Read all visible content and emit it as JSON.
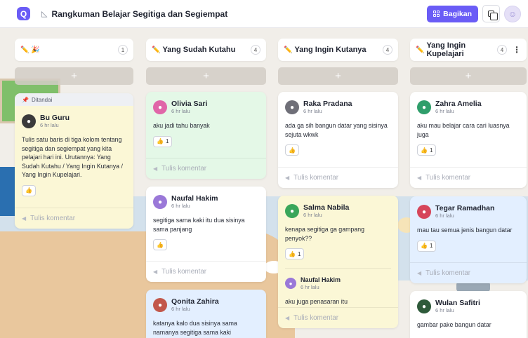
{
  "header": {
    "logo_letter": "Q",
    "title_icon": "◺",
    "title": "Rangkuman Belajar Segitiga dan Segiempat",
    "share_label": "Bagikan"
  },
  "columns": [
    {
      "title": "",
      "icons": "✏️ 🎉",
      "count": "1"
    },
    {
      "title": "Yang Sudah Kutahu",
      "icons": "✏️",
      "count": "4"
    },
    {
      "title": "Yang Ingin Kutanya",
      "icons": "✏️",
      "count": "4"
    },
    {
      "title": "Yang Ingin Kupelajari",
      "icons": "✏️",
      "count": "4"
    }
  ],
  "add_symbol": "+",
  "comment_placeholder": "Tulis komentar",
  "pinned_label": "Ditandai",
  "cards": {
    "teacher": {
      "name": "Bu Guru",
      "time": "6 hr lalu",
      "text": "Tulis satu baris di tiga kolom tentang segitiga dan segiempat yang kita pelajari hari ini. Urutannya: Yang Sudah Kutahu / Yang Ingin Kutanya / Yang Ingin Kupelajari."
    },
    "olivia": {
      "name": "Olivia Sari",
      "time": "6 hr lalu",
      "text": "aku jadi tahu banyak",
      "likes": "1"
    },
    "naufal": {
      "name": "Naufal Hakim",
      "time": "6 hr lalu",
      "text": "segitiga sama kaki itu dua sisinya sama panjang"
    },
    "qonita": {
      "name": "Qonita Zahira",
      "time": "6 hr lalu",
      "text": "katanya kalo dua sisinya sama namanya segitiga sama kaki"
    },
    "raka": {
      "name": "Raka Pradana",
      "time": "6 hr lalu",
      "text": "ada ga sih bangun datar yang sisinya sejuta wkwk"
    },
    "salma": {
      "name": "Salma Nabila",
      "time": "6 hr lalu",
      "text": "kenapa segitiga ga gampang penyok??",
      "likes": "1",
      "reply": {
        "name": "Naufal Hakim",
        "time": "6 hr lalu",
        "text": "aku juga penasaran itu"
      }
    },
    "zahra": {
      "name": "Zahra Amelia",
      "time": "6 hr lalu",
      "text": "aku mau belajar cara cari luasnya juga",
      "likes": "1"
    },
    "tegar": {
      "name": "Tegar Ramadhan",
      "time": "6 hr lalu",
      "text": "mau tau semua jenis bangun datar",
      "likes": "1"
    },
    "wulan": {
      "name": "Wulan Safitri",
      "time": "6 hr lalu",
      "text": "gambar pake bangun datar"
    }
  },
  "colors": {
    "accent": "#6a5cf6",
    "yellow_card": "#fbf7d6",
    "green_card": "#e4f8e7",
    "blue_card": "#e3efff"
  }
}
